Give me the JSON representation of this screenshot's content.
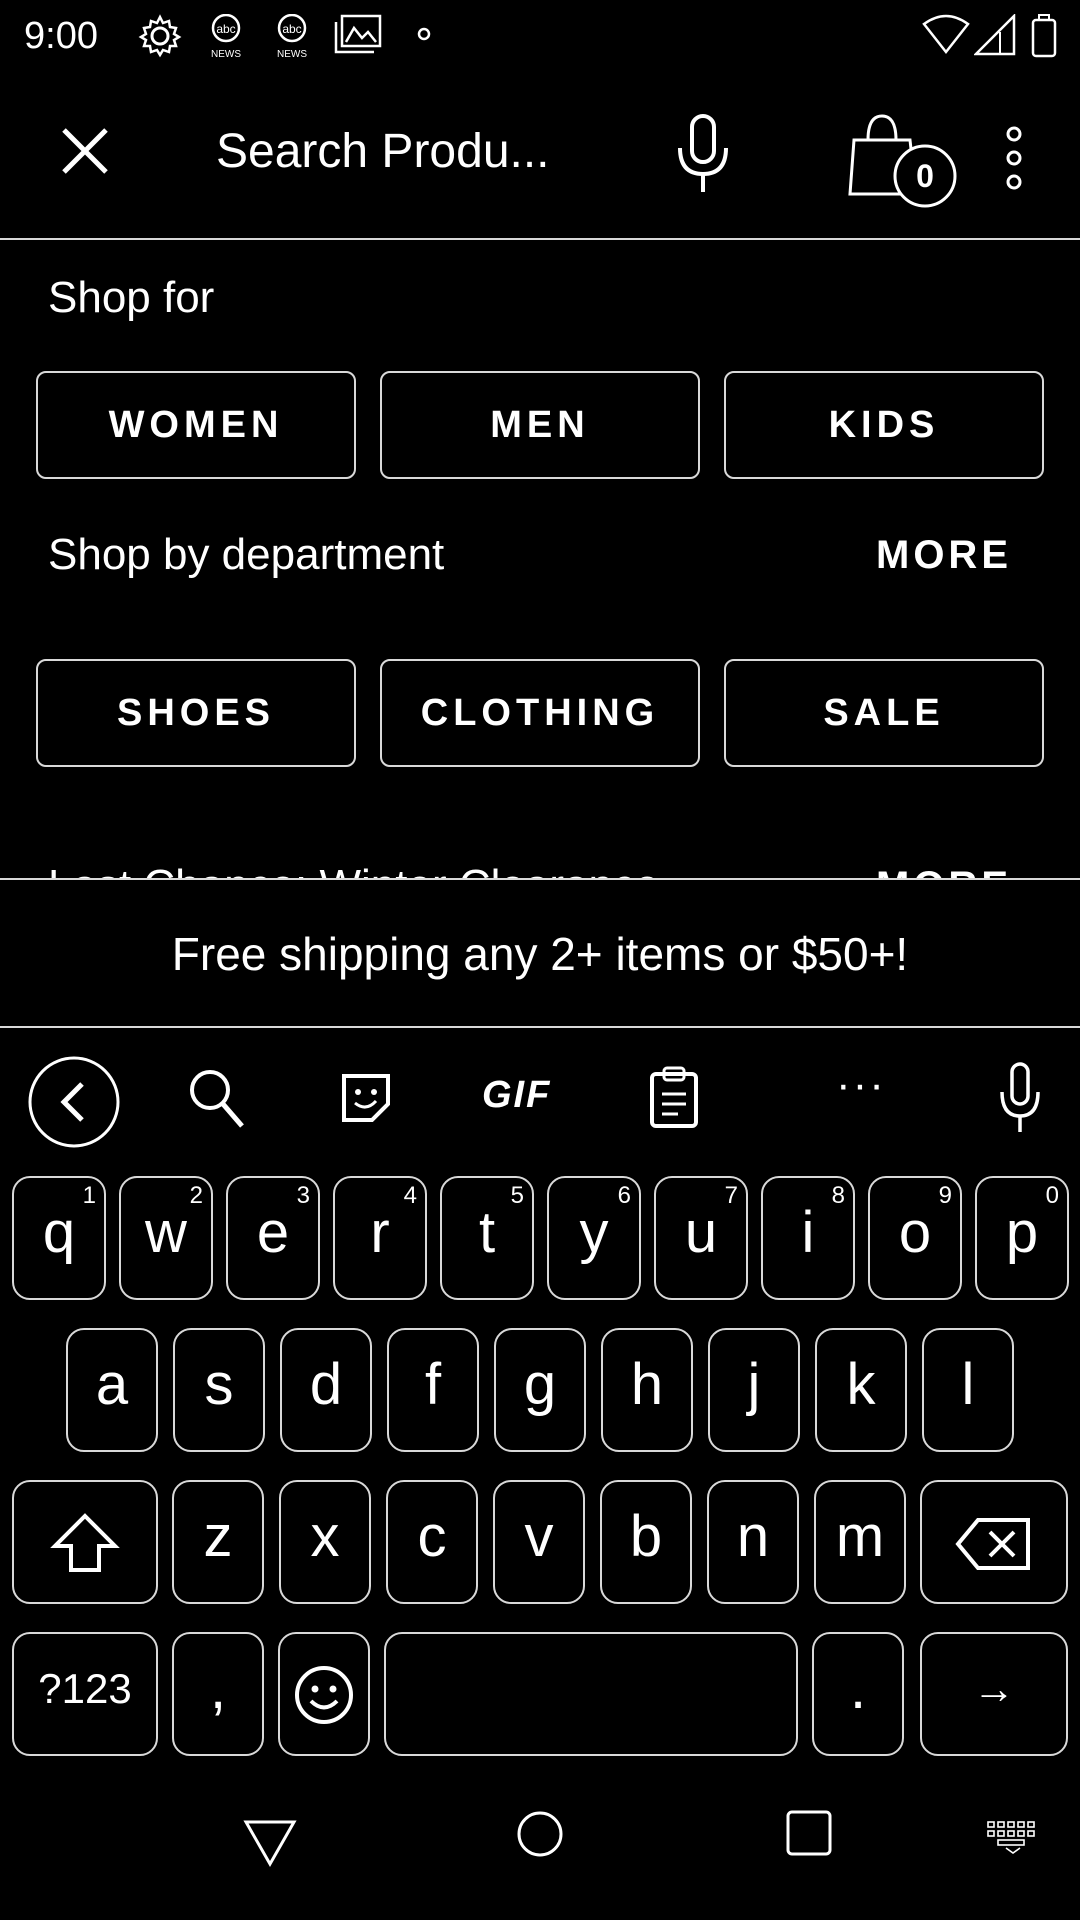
{
  "status_bar": {
    "time": "9:00",
    "icons": [
      "gear-icon",
      "abc-news-icon",
      "abc-news-icon",
      "gallery-icon",
      "dot-icon",
      "wifi-icon",
      "signal-icon",
      "battery-icon"
    ],
    "news_label": "NEWS"
  },
  "toolbar": {
    "search_text": "Search Produ...",
    "cart_count": "0"
  },
  "shop_for": {
    "title": "Shop for",
    "chips": [
      "WOMEN",
      "MEN",
      "KIDS"
    ]
  },
  "shop_by_department": {
    "title": "Shop by department",
    "more": "MORE",
    "chips": [
      "SHOES",
      "CLOTHING",
      "SALE"
    ]
  },
  "last_chance": {
    "title": "Last Chance: Winter Clearance",
    "more": "MORE"
  },
  "promo": {
    "text": "Free shipping any 2+ items or $50+!"
  },
  "keyboard": {
    "toolbar": {
      "gif": "GIF",
      "more": "···"
    },
    "rows": [
      [
        {
          "c": "q",
          "h": "1"
        },
        {
          "c": "w",
          "h": "2"
        },
        {
          "c": "e",
          "h": "3"
        },
        {
          "c": "r",
          "h": "4"
        },
        {
          "c": "t",
          "h": "5"
        },
        {
          "c": "y",
          "h": "6"
        },
        {
          "c": "u",
          "h": "7"
        },
        {
          "c": "i",
          "h": "8"
        },
        {
          "c": "o",
          "h": "9"
        },
        {
          "c": "p",
          "h": "0"
        }
      ],
      [
        {
          "c": "a"
        },
        {
          "c": "s"
        },
        {
          "c": "d"
        },
        {
          "c": "f"
        },
        {
          "c": "g"
        },
        {
          "c": "h"
        },
        {
          "c": "j"
        },
        {
          "c": "k"
        },
        {
          "c": "l"
        }
      ],
      [
        {
          "c": "z"
        },
        {
          "c": "x"
        },
        {
          "c": "c"
        },
        {
          "c": "v"
        },
        {
          "c": "b"
        },
        {
          "c": "n"
        },
        {
          "c": "m"
        }
      ]
    ],
    "symbols_key": "?123",
    "comma_key": ",",
    "period_key": ".",
    "enter_key": "→"
  }
}
